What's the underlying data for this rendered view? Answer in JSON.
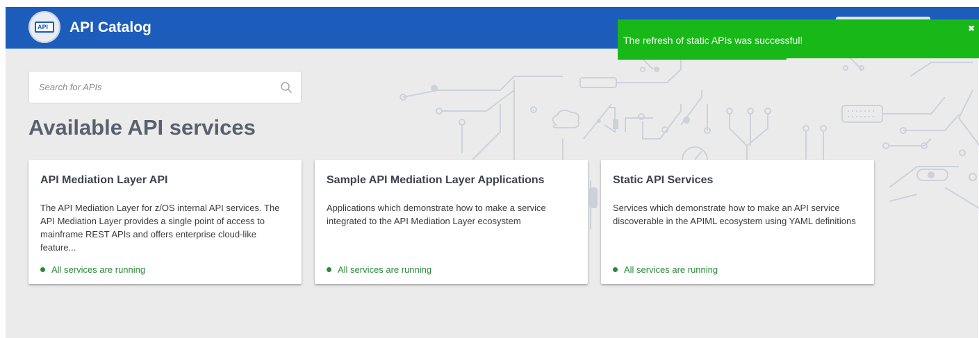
{
  "header": {
    "title": "API Catalog",
    "logo_text": "API"
  },
  "toast": {
    "message": "The refresh of static APIs was successful!",
    "close_glyph": "✖",
    "color": "#18b818"
  },
  "search": {
    "placeholder": "Search for APIs",
    "value": ""
  },
  "main": {
    "title": "Available API services"
  },
  "cards": [
    {
      "title": "API Mediation Layer API",
      "description": "The API Mediation Layer for z/OS internal API services. The API Mediation Layer provides a single point of access to mainframe REST APIs and offers enterprise cloud-like feature...",
      "status": "All services are running"
    },
    {
      "title": "Sample API Mediation Layer Applications",
      "description": "Applications which demonstrate how to make a service integrated to the API Mediation Layer ecosystem",
      "status": "All services are running"
    },
    {
      "title": "Static API Services",
      "description": "Services which demonstrate how to make an API service discoverable in the APIML ecosystem using YAML definitions",
      "status": "All services are running"
    }
  ],
  "colors": {
    "header": "#1c5dbc",
    "status_ok": "#2a8a3a",
    "title": "#59606e"
  },
  "icons": {
    "search": "search-icon",
    "close": "close-icon",
    "status": "status-dot-icon"
  }
}
